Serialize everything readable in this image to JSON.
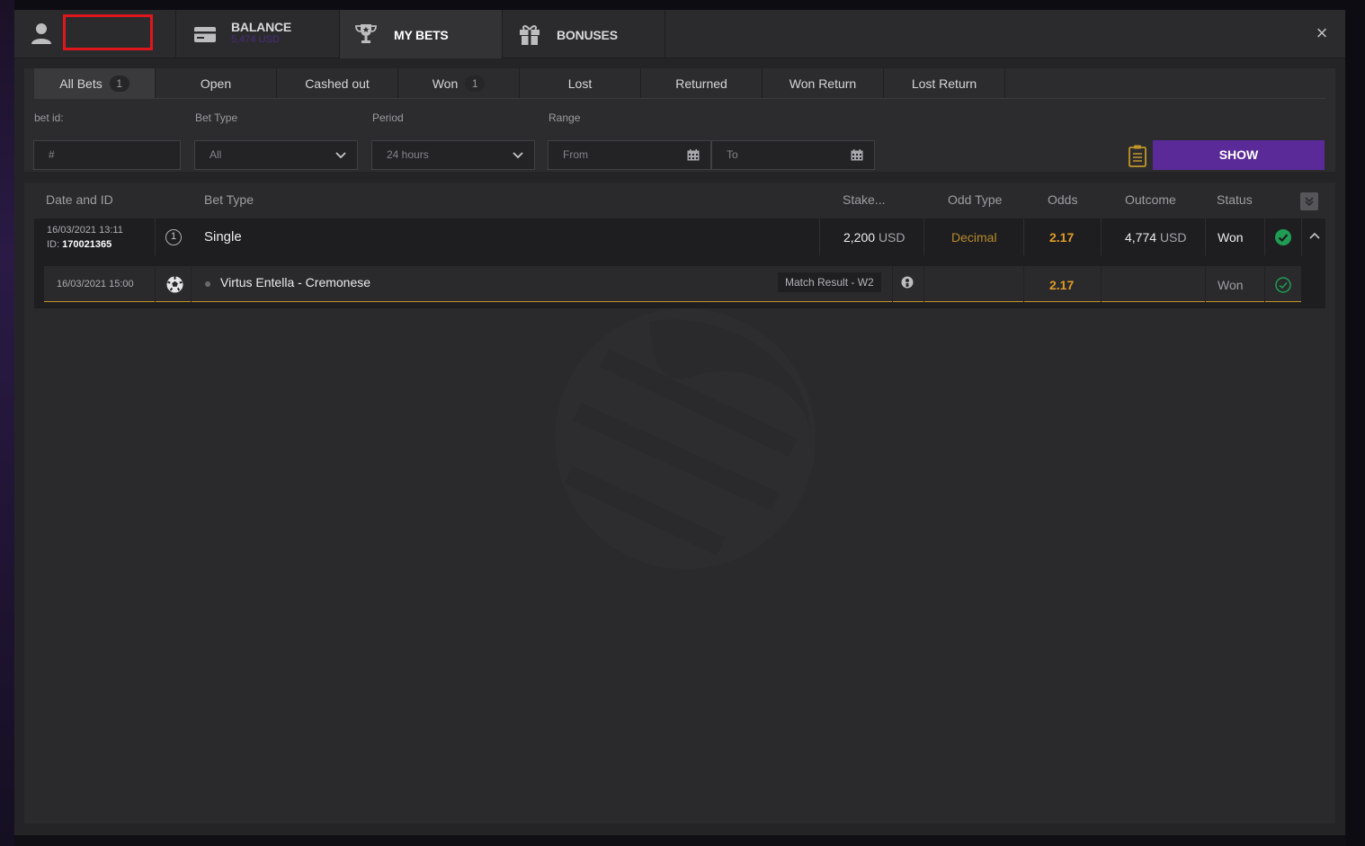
{
  "header": {
    "tabs": [
      {
        "label": "BALANCE",
        "sub": "5,474 USD",
        "icon": "wallet-icon"
      },
      {
        "label": "MY BETS",
        "icon": "trophy-icon"
      },
      {
        "label": "BONUSES",
        "icon": "gift-icon"
      }
    ],
    "close_label": "×"
  },
  "filter_tabs": [
    {
      "label": "All Bets",
      "badge": "1"
    },
    {
      "label": "Open"
    },
    {
      "label": "Cashed out"
    },
    {
      "label": "Won",
      "badge": "1"
    },
    {
      "label": "Lost"
    },
    {
      "label": "Returned"
    },
    {
      "label": "Won Return"
    },
    {
      "label": "Lost Return"
    }
  ],
  "filters": {
    "bet_id_label": "bet id:",
    "bet_id_placeholder": "#",
    "bet_type_label": "Bet Type",
    "bet_type_value": "All",
    "period_label": "Period",
    "period_value": "24 hours",
    "range_label": "Range",
    "range_from": "From",
    "range_to": "To",
    "show_label": "SHOW"
  },
  "table": {
    "headers": [
      "Date and ID",
      "Bet Type",
      "Stake...",
      "Odd Type",
      "Odds",
      "Outcome",
      "Status"
    ],
    "bet": {
      "datetime": "16/03/2021 13:11",
      "id_prefix": "ID:",
      "id": "170021365",
      "count": "1",
      "type": "Single",
      "stake": "2,200",
      "stake_currency": "USD",
      "odd_type": "Decimal",
      "odds": "2.17",
      "outcome": "4,774",
      "outcome_currency": "USD",
      "status": "Won",
      "event": {
        "datetime": "16/03/2021 15:00",
        "name": "Virtus Entella - Cremonese",
        "market": "Match Result - W2",
        "odds": "2.17",
        "status": "Won"
      }
    }
  },
  "colors": {
    "accent_purple": "#5a2a99",
    "odds_orange": "#e09c25",
    "won_green": "#1f9d55"
  }
}
